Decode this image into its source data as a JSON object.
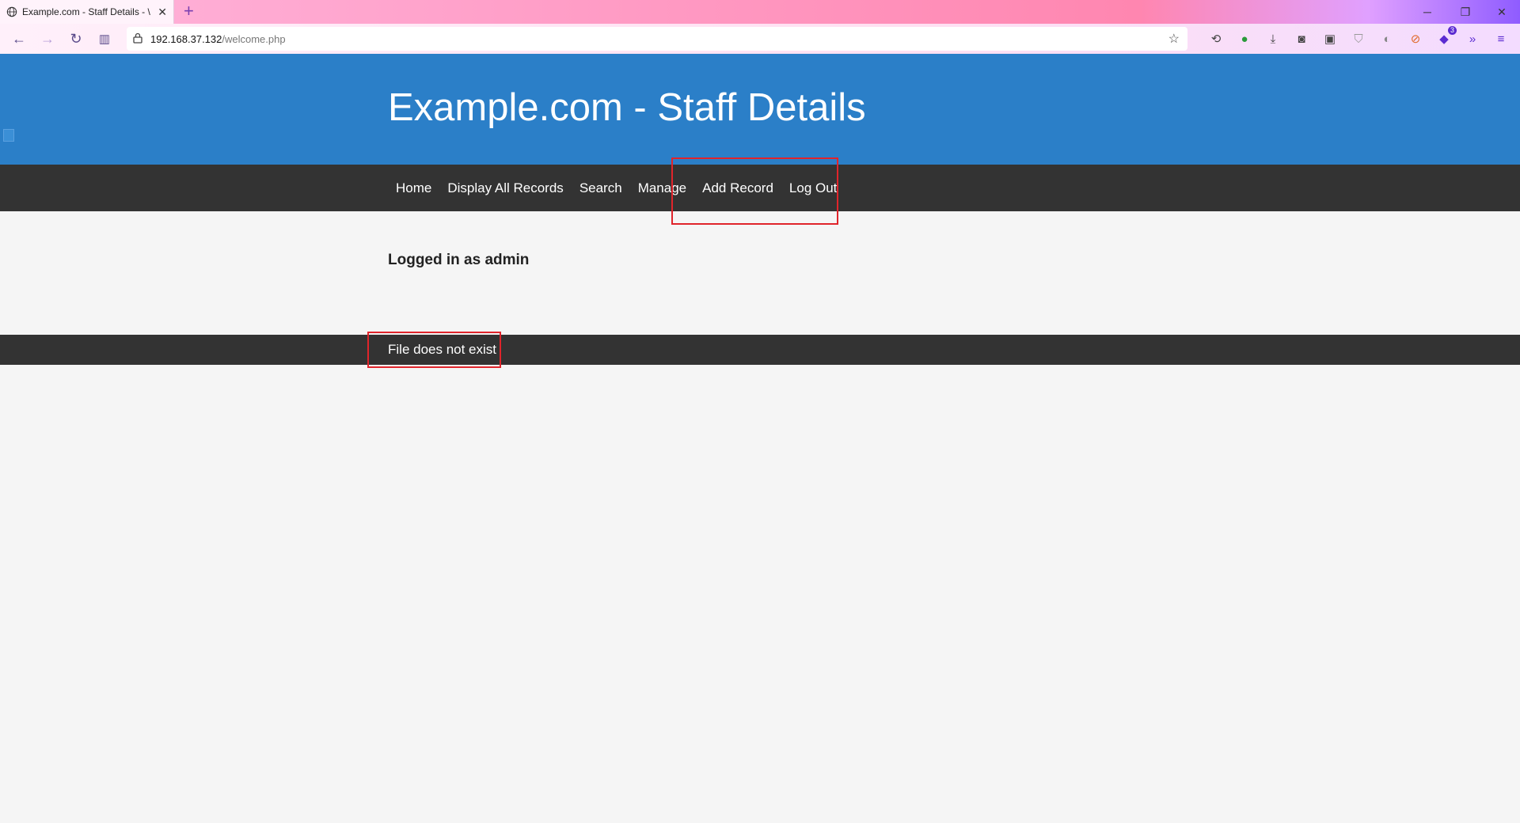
{
  "browser": {
    "tab_title": "Example.com - Staff Details - \\",
    "url_host": "192.168.37.132",
    "url_path": "/welcome.php",
    "extension_badge": "3"
  },
  "page": {
    "title": "Example.com - Staff Details",
    "nav": [
      "Home",
      "Display All Records",
      "Search",
      "Manage",
      "Add Record",
      "Log Out"
    ],
    "logged_in_text": "Logged in as admin",
    "footer_message": "File does not exist"
  },
  "colors": {
    "header_blue": "#2b7fc8",
    "nav_dark": "#333333",
    "highlight_red": "#e0242b",
    "page_bg": "#f5f5f5"
  }
}
